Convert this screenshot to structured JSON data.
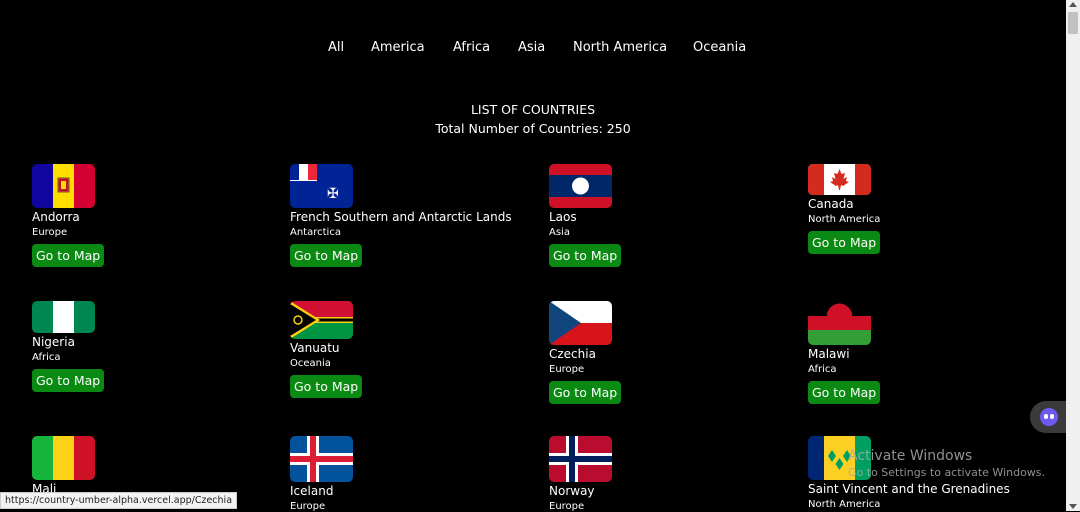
{
  "nav": [
    "All",
    "America",
    "Africa",
    "Asia",
    "North America",
    "Oceania"
  ],
  "header": {
    "title": "LIST OF COUNTRIES",
    "total": "Total Number of Countries: 250"
  },
  "button_label": "Go to Map",
  "countries": [
    {
      "name": "Andorra",
      "region": "Europe"
    },
    {
      "name": "French Southern and Antarctic Lands",
      "region": "Antarctica"
    },
    {
      "name": "Laos",
      "region": "Asia"
    },
    {
      "name": "Canada",
      "region": "North America"
    },
    {
      "name": "Nigeria",
      "region": "Africa"
    },
    {
      "name": "Vanuatu",
      "region": "Oceania"
    },
    {
      "name": "Czechia",
      "region": "Europe"
    },
    {
      "name": "Malawi",
      "region": "Africa"
    },
    {
      "name": "Mali",
      "region": ""
    },
    {
      "name": "Iceland",
      "region": "Europe"
    },
    {
      "name": "Norway",
      "region": "Europe"
    },
    {
      "name": "Saint Vincent and the Grenadines",
      "region": "North America"
    }
  ],
  "status_url": "https://country-umber-alpha.vercel.app/Czechia",
  "watermark": {
    "line1": "Activate Windows",
    "line2": "Go to Settings to activate Windows."
  }
}
